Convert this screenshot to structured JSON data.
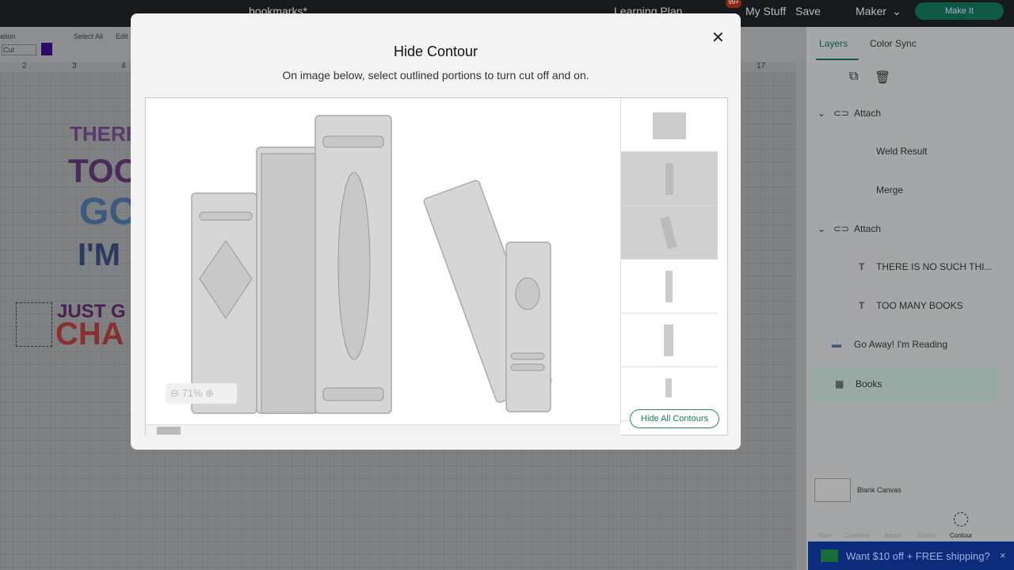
{
  "topbar": {
    "title": "bookmarks*",
    "learning": "Learning Plan",
    "notifications": "99+",
    "mystuff": "My Stuff",
    "save": "Save",
    "machine": "Maker",
    "makeit": "Make It"
  },
  "toolbar": {
    "operation": "ation",
    "op_value": "Cut",
    "select_all": "Select All",
    "edit": "Edit"
  },
  "ruler": [
    "2",
    "3",
    "4",
    "17"
  ],
  "canvas_text": [
    "THERE I",
    "TOO",
    "GO",
    "I'M",
    "JUST G",
    "CHA"
  ],
  "panel": {
    "tabs": [
      "Layers",
      "Color Sync"
    ],
    "layers": [
      {
        "label": "Attach",
        "type": "group"
      },
      {
        "label": "Weld Result",
        "type": "child"
      },
      {
        "label": "Merge",
        "type": "child"
      },
      {
        "label": "Attach",
        "type": "group"
      },
      {
        "label": "THERE IS NO SUCH THI...",
        "type": "text"
      },
      {
        "label": "TOO MANY BOOKS",
        "type": "text"
      },
      {
        "label": "Go Away! I'm Reading",
        "type": "image"
      },
      {
        "label": "Books",
        "type": "image",
        "selected": true
      }
    ],
    "blank_canvas": "Blank Canvas",
    "actions": [
      "Slice",
      "Combine",
      "Attach",
      "Flatten",
      "Contour"
    ]
  },
  "promo": "Want $10 off + FREE shipping?",
  "modal": {
    "title": "Hide Contour",
    "subtitle": "On image below, select outlined portions to turn cut off and on.",
    "zoom": "71%",
    "hide_all": "Hide All Contours",
    "thumbnails": [
      {
        "hidden": false
      },
      {
        "hidden": true
      },
      {
        "hidden": true
      },
      {
        "hidden": false
      },
      {
        "hidden": false
      },
      {
        "hidden": false
      }
    ]
  }
}
